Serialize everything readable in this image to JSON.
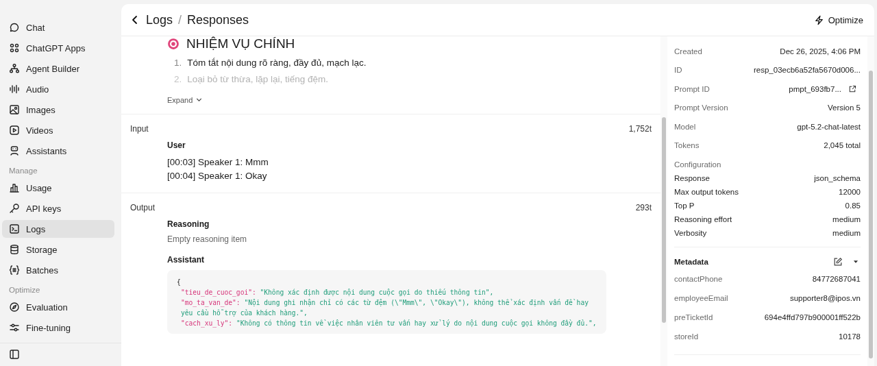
{
  "sidebar": {
    "items": [
      {
        "label": "Chat",
        "selected": false
      },
      {
        "label": "ChatGPT Apps",
        "selected": false
      },
      {
        "label": "Agent Builder",
        "selected": false
      },
      {
        "label": "Audio",
        "selected": false
      },
      {
        "label": "Images",
        "selected": false
      },
      {
        "label": "Videos",
        "selected": false
      },
      {
        "label": "Assistants",
        "selected": false
      },
      {
        "kind": "heading",
        "label": "Manage"
      },
      {
        "label": "Usage",
        "selected": false
      },
      {
        "label": "API keys",
        "selected": false
      },
      {
        "label": "Logs",
        "selected": true
      },
      {
        "label": "Storage",
        "selected": false
      },
      {
        "label": "Batches",
        "selected": false
      },
      {
        "kind": "heading",
        "label": "Optimize"
      },
      {
        "label": "Evaluation",
        "selected": false
      },
      {
        "label": "Fine-tuning",
        "selected": false
      }
    ]
  },
  "header": {
    "breadcrumb": [
      "Logs",
      "Responses"
    ],
    "separator": "/",
    "action": "Optimize"
  },
  "instructions": {
    "heading": "NHIỆM VỤ CHÍNH",
    "items": [
      {
        "number": "1.",
        "text": "Tóm tắt nội dung rõ ràng, đầy đủ, mạch lạc.",
        "faded": false
      },
      {
        "number": "2.",
        "text": "Loại bỏ từ thừa, lặp lại, tiếng đệm.",
        "faded": true
      }
    ],
    "expand": "Expand"
  },
  "input": {
    "label": "Input",
    "tokens": "1,752t",
    "role": "User",
    "lines": [
      "[00:03] Speaker 1: Mmm",
      "[00:04] Speaker 1: Okay"
    ]
  },
  "output": {
    "label": "Output",
    "tokens": "293t",
    "reasoning_title": "Reasoning",
    "reasoning_text": "Empty reasoning item",
    "assistant_title": "Assistant",
    "code_open": "{",
    "code_lines": [
      {
        "key": "\"tieu_de_cuoc_goi\":",
        "value": "\"Không xác định được nội dung cuộc gọi do thiếu thông tin\","
      },
      {
        "key": "\"mo_ta_van_de\":",
        "value": "\"Nội dung ghi nhận chỉ có các từ đệm (\\\"Mmm\\\", \\\"Okay\\\"), không thể xác định vấn đề hay yêu cầu hỗ trợ của khách hàng.\","
      },
      {
        "key": "\"cach_xu_ly\":",
        "value": "\"Không có thông tin về việc nhân viên tư vấn hay xử lý do nội dung cuộc gọi không đầy đủ.\","
      }
    ]
  },
  "details": [
    {
      "label": "Created",
      "value": "Dec 26, 2025, 4:06 PM"
    },
    {
      "label": "ID",
      "value": "resp_03ecb6a52fa5670d006..."
    },
    {
      "label": "Prompt ID",
      "value": "pmpt_693fb7...",
      "link": true
    },
    {
      "label": "Prompt Version",
      "value": "Version 5"
    },
    {
      "label": "Model",
      "value": "gpt-5.2-chat-latest"
    },
    {
      "label": "Tokens",
      "value": "2,045 total"
    }
  ],
  "configuration": {
    "title": "Configuration",
    "rows": [
      {
        "label": "Response",
        "value": "json_schema"
      },
      {
        "label": "Max output tokens",
        "value": "12000"
      },
      {
        "label": "Top P",
        "value": "0.85"
      },
      {
        "label": "Reasoning effort",
        "value": "medium"
      },
      {
        "label": "Verbosity",
        "value": "medium"
      }
    ]
  },
  "metadata": {
    "title": "Metadata",
    "rows": [
      {
        "label": "contactPhone",
        "value": "84772687041"
      },
      {
        "label": "employeeEmail",
        "value": "supporter8@ipos.vn"
      },
      {
        "label": "preTicketId",
        "value": "694e4ffd797b900001ff522b"
      },
      {
        "label": "storeId",
        "value": "10178"
      }
    ]
  }
}
